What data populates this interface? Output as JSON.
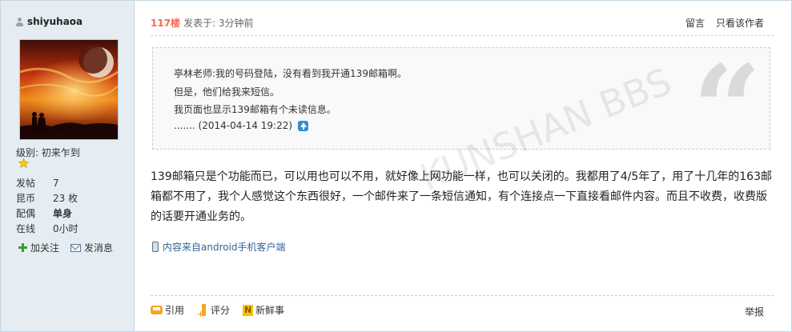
{
  "user": {
    "name": "shiyuhaoa",
    "level_label": "级别: 初来乍到",
    "stats": [
      {
        "key": "发帖",
        "value": "7",
        "bold": false
      },
      {
        "key": "昆币",
        "value": "23 枚",
        "bold": false
      },
      {
        "key": "配偶",
        "value": "单身",
        "bold": true
      },
      {
        "key": "在线",
        "value": "0小时",
        "bold": false
      }
    ],
    "actions": {
      "follow": "加关注",
      "message": "发消息"
    }
  },
  "post": {
    "floor": "117楼",
    "posted_at": "发表于: 3分钟前",
    "header_links": {
      "comment": "留言",
      "author_only": "只看该作者"
    },
    "quote": {
      "lines": [
        "亭林老师:我的号码登陆，没有看到我开通139邮箱啊。",
        "但是，他们给我来短信。",
        "我页面也显示139邮箱有个未读信息。"
      ],
      "meta_dots": ".......",
      "meta_time": "(2014-04-14 19:22)"
    },
    "content_lines": [
      "139邮箱只是个功能而已，可以用也可以不用，就好像上网功能一样，也可以关闭的。我都用了4/5年了，用了十几年的163邮",
      "箱都不用了，我个人感觉这个东西很好，一个邮件来了一条短信通知，有个连接点一下直接看邮件内容。而且不收费，收费版",
      "的话要开通业务的。"
    ],
    "source": "内容来自android手机客户端",
    "footer": {
      "reply": "引用",
      "rate": "评分",
      "new": "新鲜事",
      "report": "举报"
    }
  },
  "watermark": "KUNSHAN BBS",
  "colors": {
    "sidebar_bg": "#e5edf2",
    "floor": "#f26c4f",
    "link": "#336699",
    "accent_orange": "#f5a623"
  }
}
